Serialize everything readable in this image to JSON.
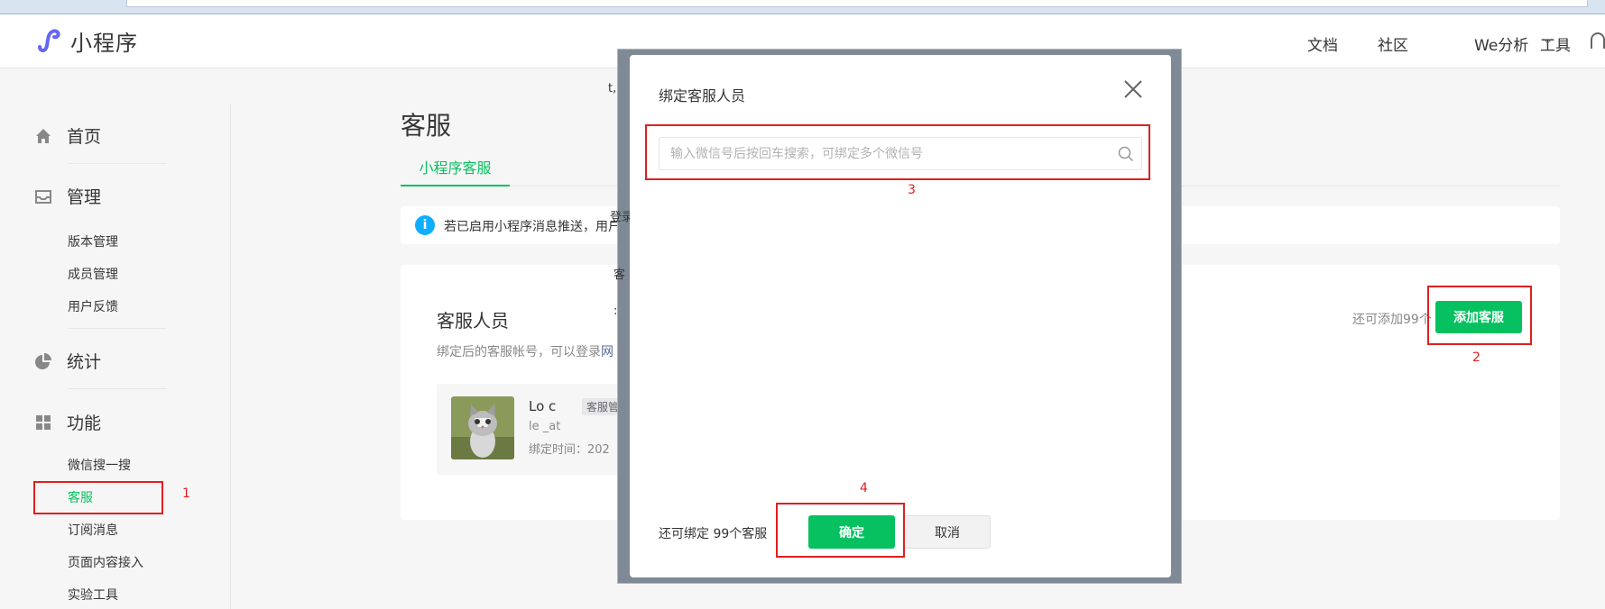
{
  "header": {
    "logo_text": "小程序",
    "nav": [
      {
        "label": "文档",
        "has_dropdown": false
      },
      {
        "label": "社区",
        "has_dropdown": true
      },
      {
        "label": "We分析",
        "has_dropdown": false
      },
      {
        "label": "工具",
        "has_dropdown": true
      }
    ]
  },
  "sidebar": {
    "home": "首页",
    "manage": "管理",
    "manage_items": [
      "版本管理",
      "成员管理",
      "用户反馈"
    ],
    "stats": "统计",
    "features": "功能",
    "feature_items": [
      "微信搜一搜",
      "客服",
      "订阅消息",
      "页面内容接入",
      "实验工具"
    ],
    "active_item": "客服"
  },
  "main": {
    "title": "客服",
    "tab": "小程序客服",
    "notice_text": "若已启用小程序消息推送，用户",
    "section_title": "客服人员",
    "section_desc": "绑定后的客服帐号，可以登录",
    "section_desc_link": "网",
    "remaining_text": "还可添加99个",
    "add_button": "添加客服",
    "member": {
      "name": "Lo  c",
      "badge": "客服管",
      "account": "le  _at",
      "bind_time": "绑定时间：202"
    }
  },
  "background_peek": [
    "t,",
    "登录",
    "客",
    ":"
  ],
  "modal": {
    "title": "绑定客服人员",
    "search_placeholder": "输入微信号后按回车搜索，可绑定多个微信号",
    "remaining_text": "还可绑定 99个客服",
    "confirm_button": "确定",
    "cancel_button": "取消"
  },
  "annotations": [
    "1",
    "2",
    "3",
    "4"
  ],
  "colors": {
    "brand_green": "#07c160",
    "annotation_red": "#e02020",
    "info_blue": "#10aeff",
    "logo_purple": "#6467f0"
  }
}
